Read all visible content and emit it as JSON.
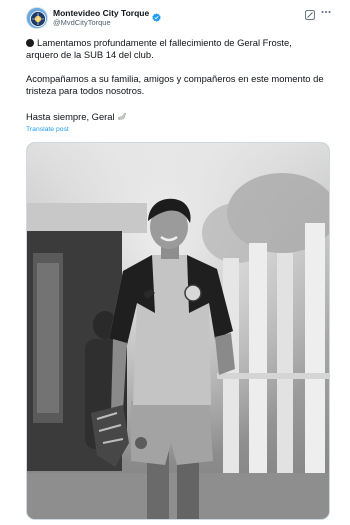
{
  "header": {
    "display_name": "Montevideo City Torque",
    "handle": "@MvdCityTorque",
    "avatar_icon": "club-crest-icon",
    "verified_icon": "verified-badge-icon",
    "verified_color": "#1d9bf0",
    "grok_icon": "grok-icon",
    "more_icon": "more-options-icon"
  },
  "post": {
    "line1a_icon": "black-circle-icon",
    "line1a": "Lamentamos profundamente el fallecimiento de Geral Froste,",
    "line1b": "arquero de la SUB 14 del club.",
    "line2a": "Acompañamos a su familia, amigos y compañeros en este momento de",
    "line2b": "tristeza para todos nosotros.",
    "line3": "Hasta siempre, Geral",
    "line3_icon": "dove-icon",
    "translate_label": "Translate post"
  },
  "media": {
    "photo": "black-and-white-photo-of-young-goalkeeper"
  },
  "colors": {
    "text": "#0f1419",
    "secondary": "#536471",
    "link": "#1d9bf0"
  }
}
